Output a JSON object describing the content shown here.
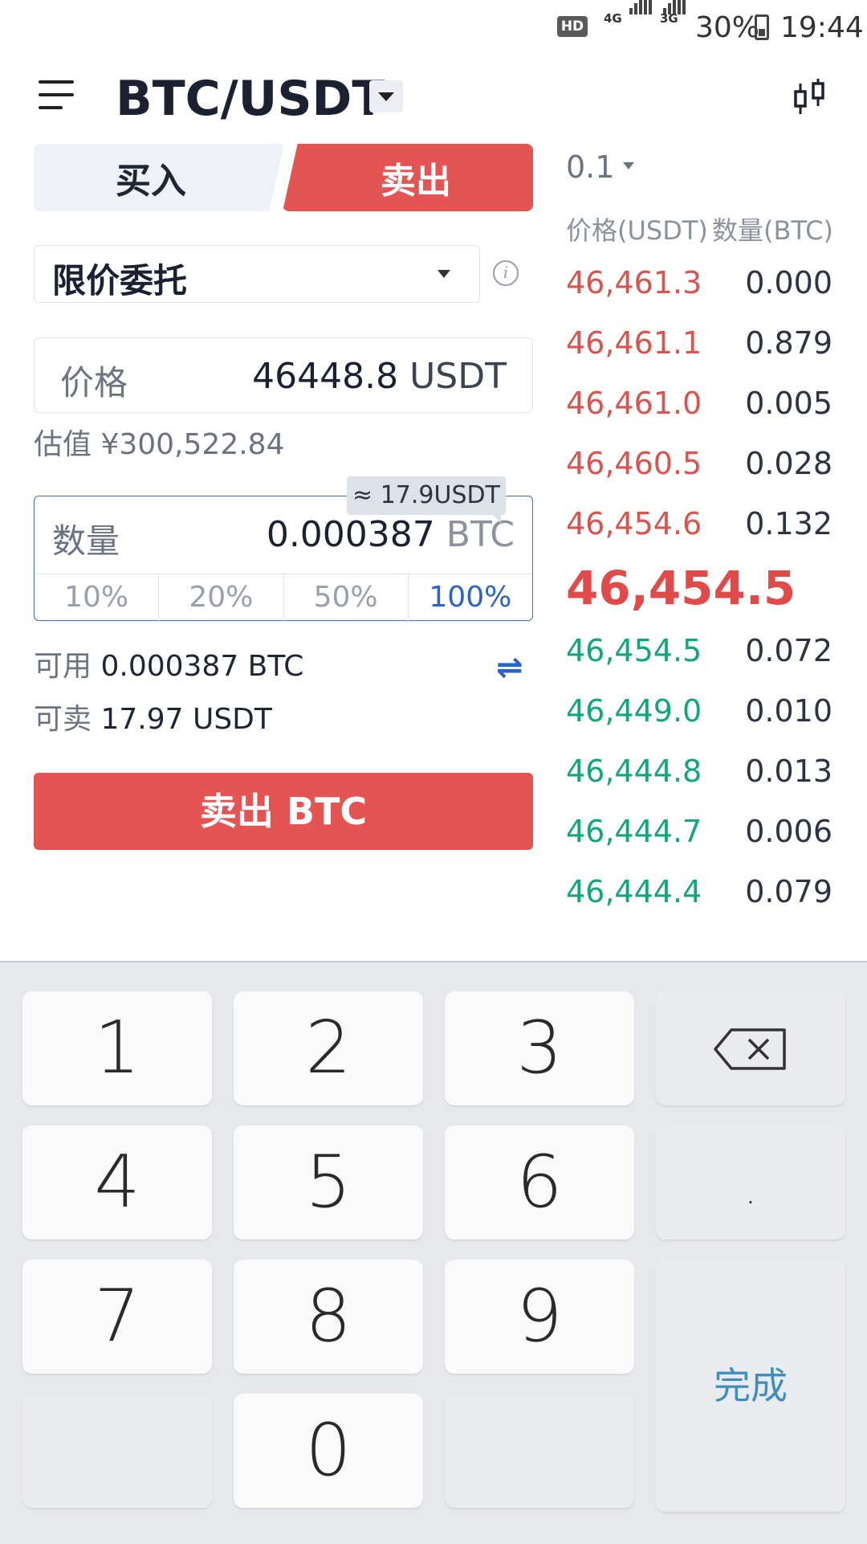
{
  "status_bar": {
    "hd": "HD",
    "net1": "4G",
    "net2": "3G",
    "battery": "30%",
    "time": "19:44"
  },
  "header": {
    "pair": "BTC/USDT",
    "icons": [
      "menu-icon",
      "dropdown-icon",
      "candlestick-chart-icon"
    ]
  },
  "tabs": {
    "buy": "买入",
    "sell": "卖出",
    "active": "sell"
  },
  "order_type": {
    "label": "限价委托"
  },
  "price": {
    "label": "价格",
    "value": "46448.8",
    "unit": "USDT",
    "estimate": "估值 ¥300,522.84"
  },
  "quantity": {
    "label": "数量",
    "value": "0.000387",
    "unit": "BTC",
    "tooltip": "≈ 17.9USDT",
    "percents": [
      "10%",
      "20%",
      "50%",
      "100%"
    ],
    "selected_percent": "100%"
  },
  "balances": {
    "available_label": "可用",
    "available_value": "0.000387 BTC",
    "sellable_label": "可卖",
    "sellable_value": "17.97 USDT"
  },
  "action": {
    "sell_button": "卖出 BTC"
  },
  "order_book": {
    "depth": "0.1",
    "head_price": "价格(USDT)",
    "head_qty": "数量(BTC)",
    "asks": [
      {
        "price": "46,461.3",
        "qty": "0.000"
      },
      {
        "price": "46,461.1",
        "qty": "0.879"
      },
      {
        "price": "46,461.0",
        "qty": "0.005"
      },
      {
        "price": "46,460.5",
        "qty": "0.028"
      },
      {
        "price": "46,454.6",
        "qty": "0.132"
      }
    ],
    "last_price": "46,454.5",
    "bids": [
      {
        "price": "46,454.5",
        "qty": "0.072"
      },
      {
        "price": "46,449.0",
        "qty": "0.010"
      },
      {
        "price": "46,444.8",
        "qty": "0.013"
      },
      {
        "price": "46,444.7",
        "qty": "0.006"
      },
      {
        "price": "46,444.4",
        "qty": "0.079"
      }
    ]
  },
  "keyboard": {
    "keys": [
      "1",
      "2",
      "3",
      "4",
      "5",
      "6",
      ".",
      "7",
      "8",
      "9",
      "0"
    ],
    "done": "完成"
  },
  "colors": {
    "sell": "#e45453",
    "ask": "#d9534f",
    "bid": "#12a77a",
    "accent": "#2a63c9"
  }
}
